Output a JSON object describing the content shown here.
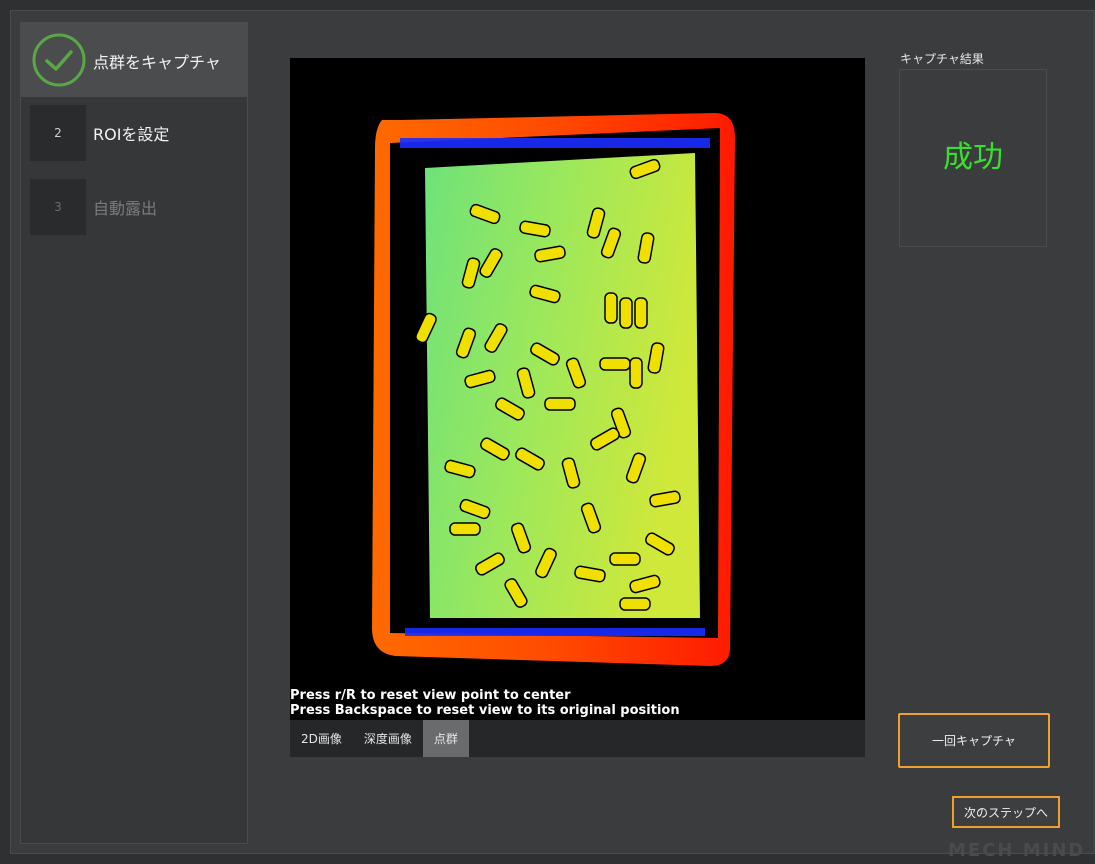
{
  "steps": [
    {
      "number": "",
      "label": "点群をキャプチャ",
      "state": "done"
    },
    {
      "number": "2",
      "label": "ROIを設定",
      "state": "current"
    },
    {
      "number": "3",
      "label": "自動露出",
      "state": "disabled"
    }
  ],
  "viewer": {
    "hint_line1": "Press r/R to reset view point to center",
    "hint_line2": "Press Backspace to reset view to its original position",
    "tabs": [
      {
        "label": "2D画像",
        "selected": false
      },
      {
        "label": "深度画像",
        "selected": false
      },
      {
        "label": "点群",
        "selected": true
      }
    ]
  },
  "result": {
    "title": "キャプチャ結果",
    "status": "成功",
    "status_color": "#38e02e"
  },
  "buttons": {
    "capture_once": "一回キャプチャ",
    "next_step": "次のステップへ"
  },
  "watermark": "MECH MIND",
  "colors": {
    "accent": "#f0a030",
    "success": "#38e02e",
    "check": "#5aa845"
  }
}
